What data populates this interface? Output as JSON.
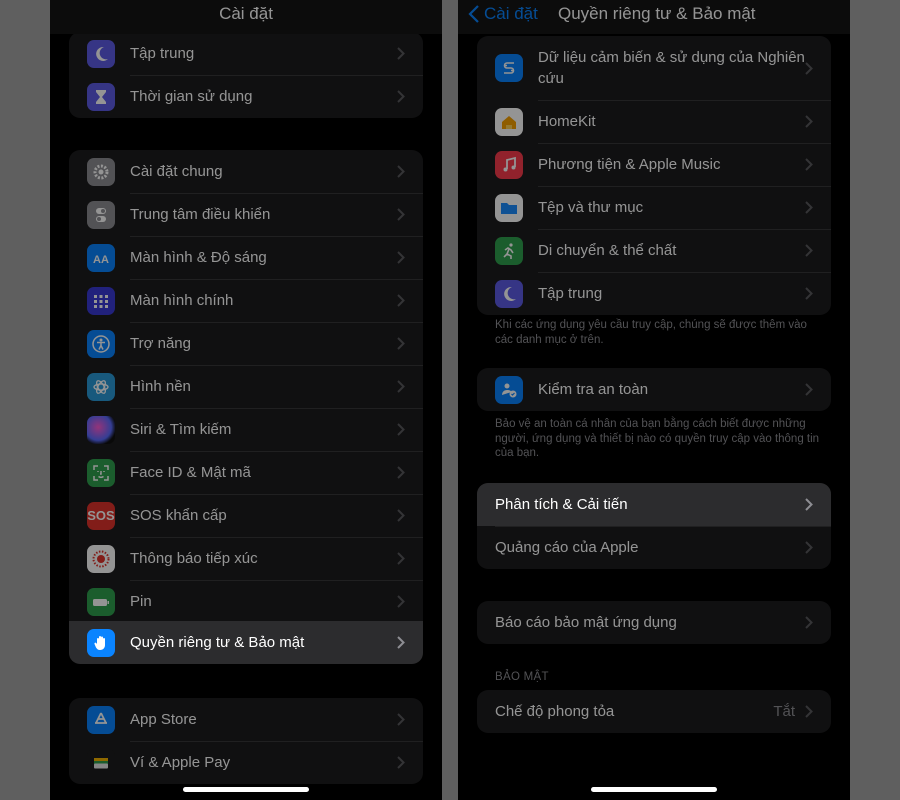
{
  "left": {
    "title": "Cài đặt",
    "group1": [
      {
        "label": "Tập trung",
        "icon": "moon-icon",
        "color": "#5e5ce6"
      },
      {
        "label": "Thời gian sử dụng",
        "icon": "hourglass-icon",
        "color": "#5e5ce6"
      }
    ],
    "group2": [
      {
        "label": "Cài đặt chung",
        "icon": "gear-icon",
        "color": "#8e8e93"
      },
      {
        "label": "Trung tâm điều khiển",
        "icon": "toggles-icon",
        "color": "#8e8e93"
      },
      {
        "label": "Màn hình & Độ sáng",
        "icon": "text-size-icon",
        "color": "#0a84ff"
      },
      {
        "label": "Màn hình chính",
        "icon": "app-grid-icon",
        "color": "#3a3ad6"
      },
      {
        "label": "Trợ năng",
        "icon": "accessibility-icon",
        "color": "#0a84ff"
      },
      {
        "label": "Hình nền",
        "icon": "flower-icon",
        "color": "#2a9ad8"
      },
      {
        "label": "Siri & Tìm kiếm",
        "icon": "siri-icon",
        "color": "#1c1c1e"
      },
      {
        "label": "Face ID & Mật mã",
        "icon": "face-id-icon",
        "color": "#30a14e"
      },
      {
        "label": "SOS khẩn cấp",
        "icon": "sos-icon",
        "color": "#e0322b",
        "text": "SOS"
      },
      {
        "label": "Thông báo tiếp xúc",
        "icon": "exposure-icon",
        "color": "#ffffff"
      },
      {
        "label": "Pin",
        "icon": "battery-icon",
        "color": "#30a14e"
      },
      {
        "label": "Quyền riêng tư & Bảo mật",
        "icon": "hand-icon",
        "color": "#0a84ff"
      }
    ],
    "group3": [
      {
        "label": "App Store",
        "icon": "app-store-icon",
        "color": "#0a84ff"
      },
      {
        "label": "Ví & Apple Pay",
        "icon": "wallet-icon",
        "color": "#1c1c1e"
      }
    ]
  },
  "right": {
    "back_label": "Cài đặt",
    "title": "Quyền riêng tư & Bảo mật",
    "group1": [
      {
        "label": "Dữ liệu cảm biến & sử dụng của Nghiên cứu",
        "icon": "research-icon",
        "color": "#0a84ff"
      },
      {
        "label": "HomeKit",
        "icon": "home-icon",
        "color": "#ffffff"
      },
      {
        "label": "Phương tiện & Apple Music",
        "icon": "music-icon",
        "color": "#fa3c4c"
      },
      {
        "label": "Tệp và thư mục",
        "icon": "folder-icon",
        "color": "#ffffff"
      },
      {
        "label": "Di chuyển & thể chất",
        "icon": "running-icon",
        "color": "#30a14e"
      },
      {
        "label": "Tập trung",
        "icon": "moon-icon",
        "color": "#5e5ce6"
      }
    ],
    "note1": "Khi các ứng dụng yêu cầu truy cập, chúng sẽ được thêm vào các danh mục ở trên.",
    "safety": {
      "label": "Kiểm tra an toàn",
      "icon": "safety-check-icon",
      "color": "#0a84ff"
    },
    "note2": "Bảo vệ an toàn cá nhân của bạn bằng cách biết được những người, ứng dụng và thiết bị nào có quyền truy cập vào thông tin của bạn.",
    "group3": [
      {
        "label": "Phân tích & Cải tiến"
      },
      {
        "label": "Quảng cáo của Apple"
      }
    ],
    "report": {
      "label": "Báo cáo bảo mật ứng dụng"
    },
    "security_header": "BẢO MẬT",
    "lockdown": {
      "label": "Chế độ phong tỏa",
      "value": "Tắt"
    }
  }
}
